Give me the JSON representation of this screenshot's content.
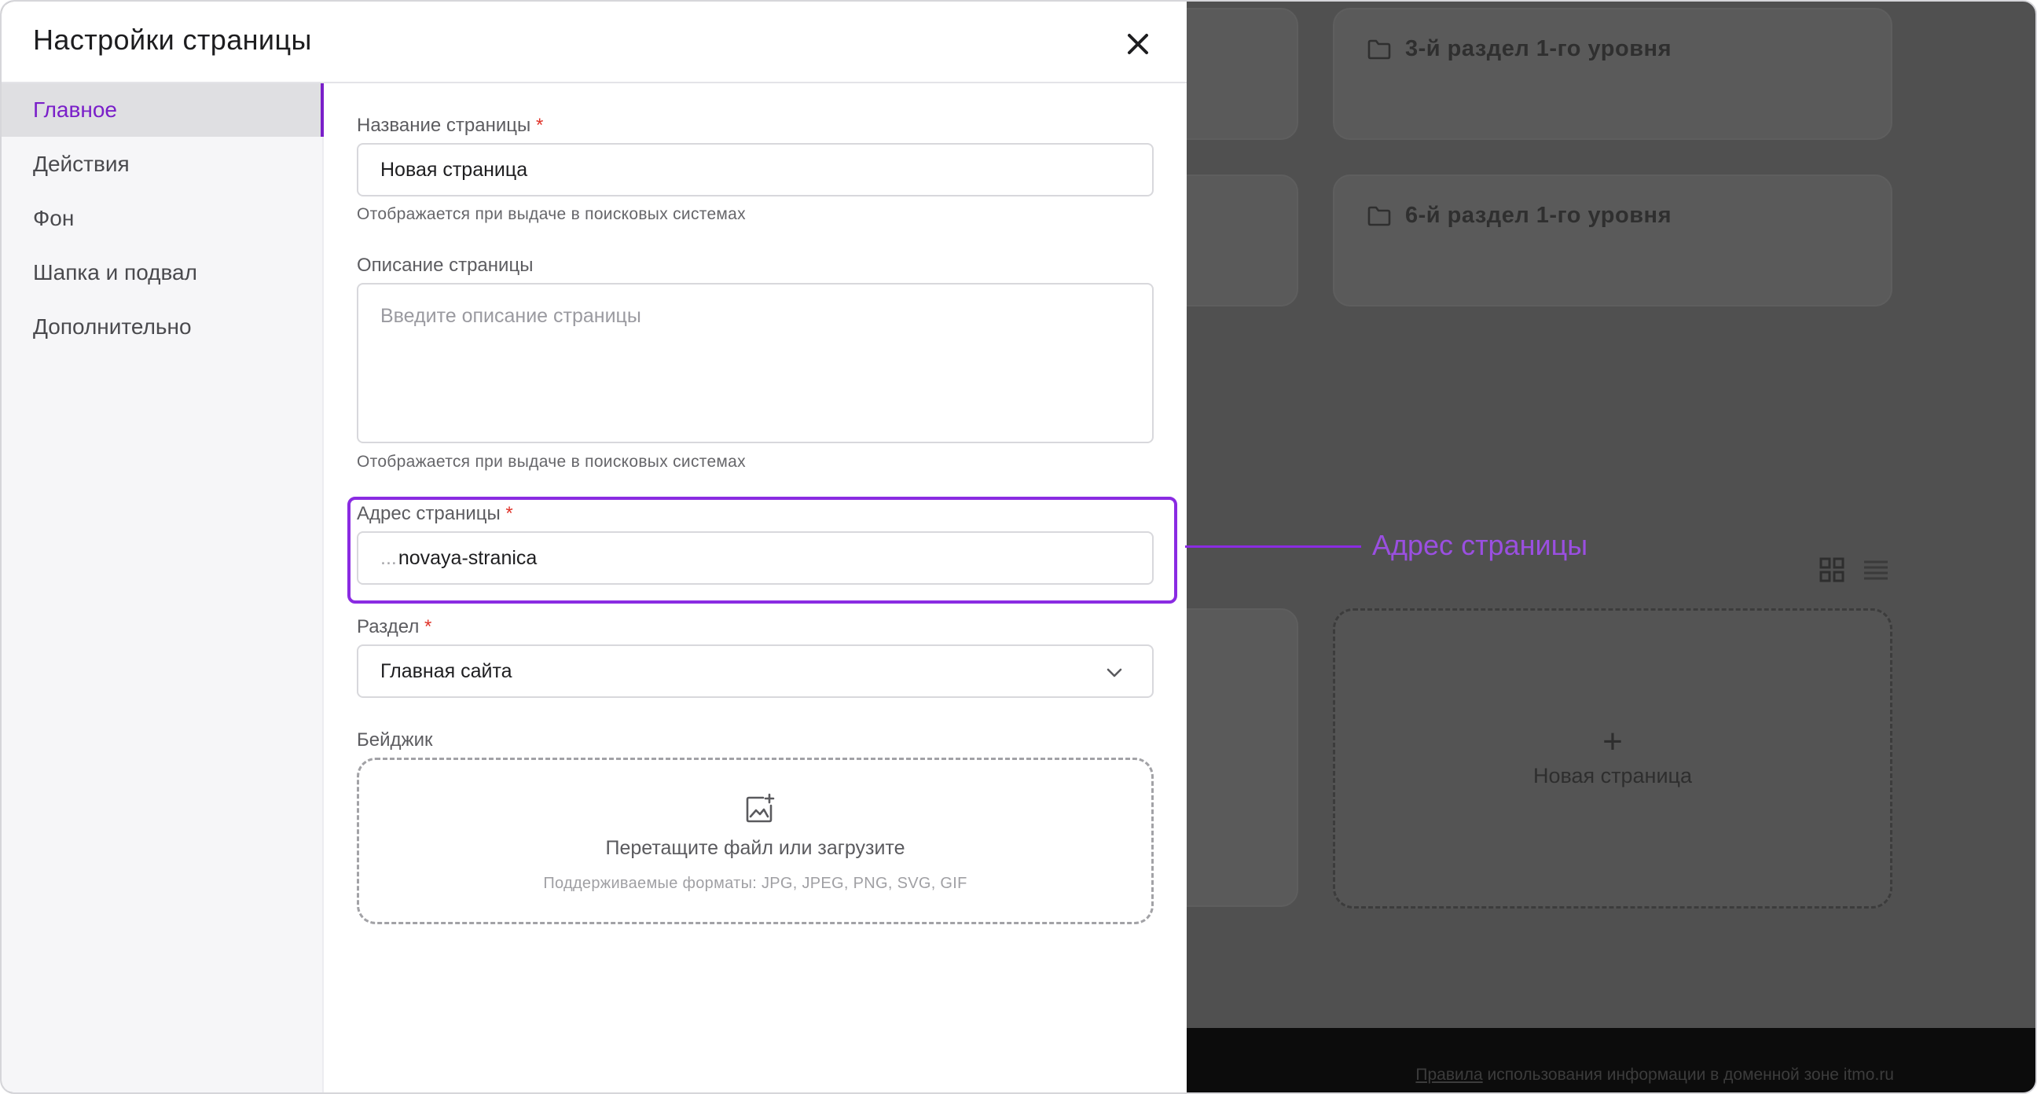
{
  "modal": {
    "title": "Настройки страницы",
    "sidebar": {
      "items": [
        {
          "label": "Главное",
          "active": true
        },
        {
          "label": "Действия",
          "active": false
        },
        {
          "label": "Фон",
          "active": false
        },
        {
          "label": "Шапка и подвал",
          "active": false
        },
        {
          "label": "Дополнительно",
          "active": false
        }
      ]
    },
    "fields": {
      "page_name": {
        "label": "Название страницы",
        "required_mark": "*",
        "value": "Новая страница",
        "hint": "Отображается при выдаче в поисковых системах"
      },
      "description": {
        "label": "Описание страницы",
        "placeholder": "Введите описание страницы",
        "hint": "Отображается при выдаче в поисковых системах"
      },
      "address": {
        "label": "Адрес страницы",
        "required_mark": "*",
        "prefix": "...",
        "value": "novaya-stranica"
      },
      "section": {
        "label": "Раздел",
        "required_mark": "*",
        "value": "Главная сайта"
      },
      "badge": {
        "label": "Бейджик",
        "drop_title": "Перетащите файл или загрузите",
        "drop_formats": "Поддерживаемые форматы: JPG, JPEG, PNG, SVG, GIF"
      }
    }
  },
  "background": {
    "sections": [
      {
        "title": "3-й раздел 1-го уровня",
        "icon": "folder-icon"
      },
      {
        "title": "6-й раздел 1-го уровня",
        "icon": "folder-icon"
      }
    ],
    "new_page": {
      "plus": "+",
      "label": "Новая страница"
    },
    "footer": {
      "link": "Правила",
      "text": " использования информации в доменной зоне itmo.ru"
    }
  },
  "annotation": {
    "label": "Адрес страницы"
  },
  "colors": {
    "accent": "#8a2be2",
    "active_text": "#7a1fc9",
    "required": "#e0342a",
    "overlay": "#505050"
  }
}
